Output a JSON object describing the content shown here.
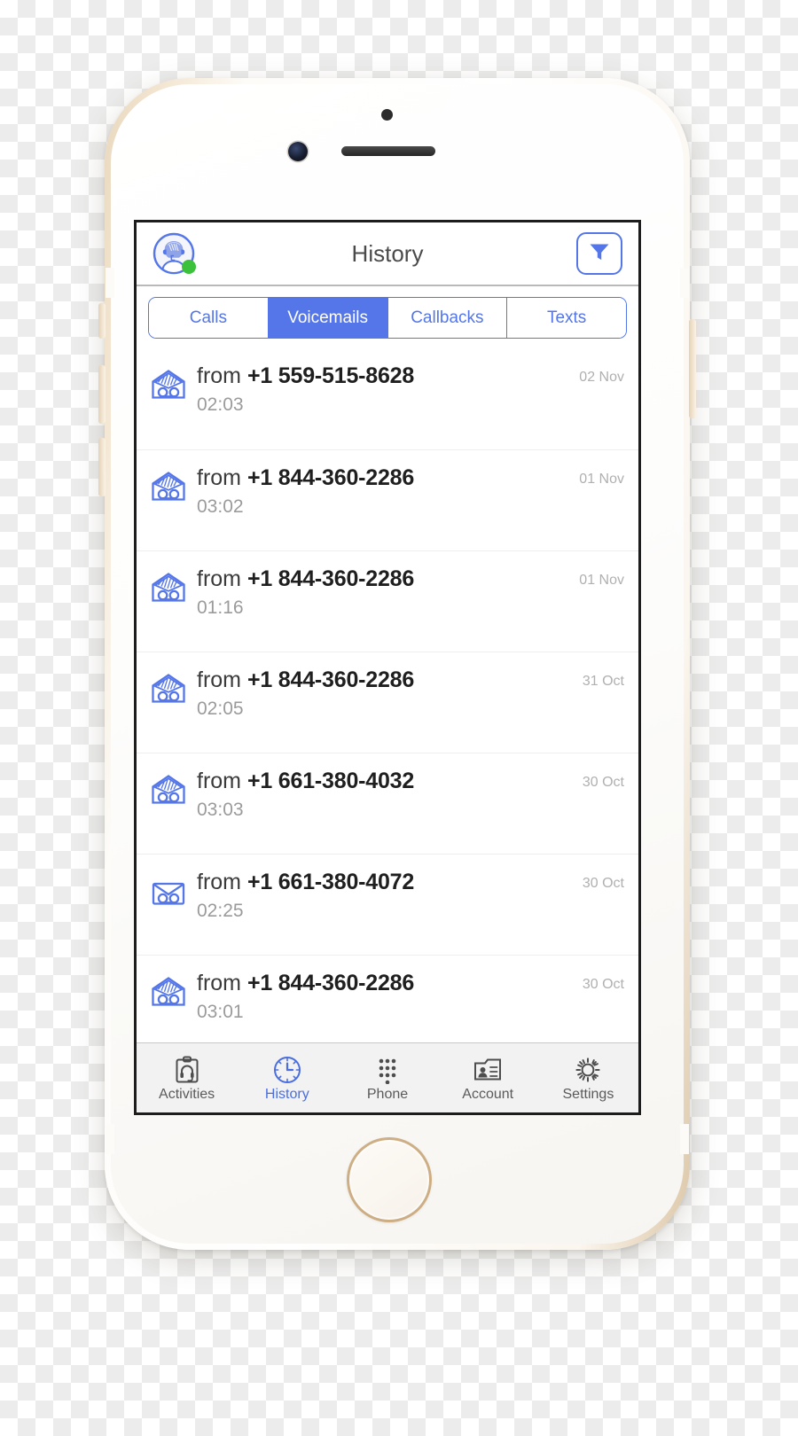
{
  "device": {
    "name": "iphone-gold-white",
    "hardware": {
      "front_camera": "front-camera",
      "earpiece": "earpiece-speaker",
      "proximity_sensor": "proximity-sensor",
      "home_button": "home-button"
    }
  },
  "colors": {
    "accent_blue": "#5476e8",
    "tab_active_blue": "#4a6ee0",
    "presence_green": "#3cc13c",
    "text_primary": "#1f1f1f",
    "text_secondary": "#9b9b9b",
    "date_gray": "#b0b0b0"
  },
  "navbar": {
    "title": "History",
    "avatar_icon": "agent-headset-avatar-icon",
    "presence_status": "online",
    "filter_icon": "filter-funnel-icon"
  },
  "segmented_control": {
    "selected": "Voicemails",
    "segments": [
      {
        "label": "Calls",
        "active": false
      },
      {
        "label": "Voicemails",
        "active": true
      },
      {
        "label": "Callbacks",
        "active": false
      },
      {
        "label": "Texts",
        "active": false
      }
    ]
  },
  "voicemails": [
    {
      "prefix": "from",
      "number": "+1 559-515-8628",
      "duration": "02:03",
      "date": "02 Nov",
      "icon": "voicemail-open-envelope-icon"
    },
    {
      "prefix": "from",
      "number": "+1 844-360-2286",
      "duration": "03:02",
      "date": "01 Nov",
      "icon": "voicemail-open-envelope-icon"
    },
    {
      "prefix": "from",
      "number": "+1 844-360-2286",
      "duration": "01:16",
      "date": "01 Nov",
      "icon": "voicemail-open-envelope-icon"
    },
    {
      "prefix": "from",
      "number": "+1 844-360-2286",
      "duration": "02:05",
      "date": "31 Oct",
      "icon": "voicemail-open-envelope-icon"
    },
    {
      "prefix": "from",
      "number": "+1 661-380-4032",
      "duration": "03:03",
      "date": "30 Oct",
      "icon": "voicemail-open-envelope-icon"
    },
    {
      "prefix": "from",
      "number": "+1 661-380-4072",
      "duration": "02:25",
      "date": "30 Oct",
      "icon": "voicemail-sealed-envelope-icon"
    },
    {
      "prefix": "from",
      "number": "+1 844-360-2286",
      "duration": "03:01",
      "date": "30 Oct",
      "icon": "voicemail-open-envelope-icon"
    }
  ],
  "tabbar": {
    "active": "History",
    "tabs": [
      {
        "label": "Activities",
        "icon": "clipboard-headset-icon",
        "active": false
      },
      {
        "label": "History",
        "icon": "clock-icon",
        "active": true
      },
      {
        "label": "Phone",
        "icon": "dialpad-icon",
        "active": false
      },
      {
        "label": "Account",
        "icon": "contact-card-icon",
        "active": false
      },
      {
        "label": "Settings",
        "icon": "gear-icon",
        "active": false
      }
    ]
  }
}
